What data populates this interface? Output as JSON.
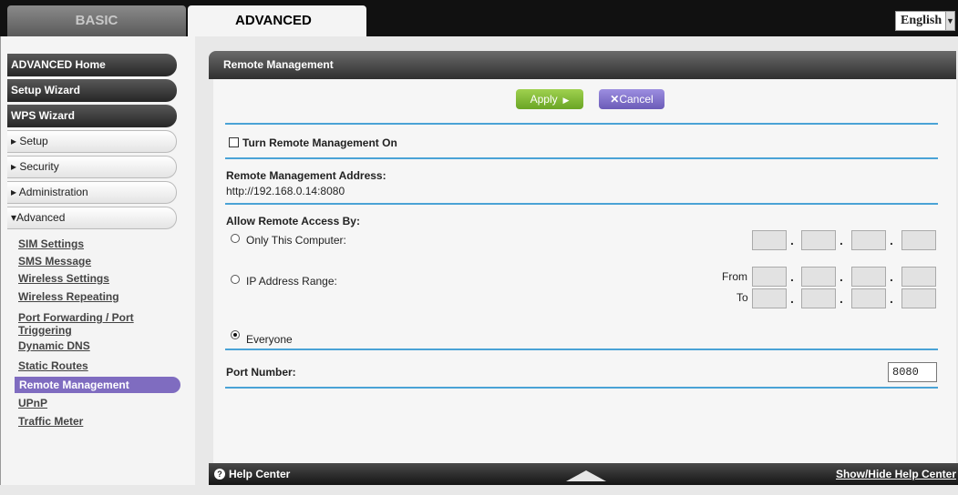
{
  "tabs": {
    "basic": "BASIC",
    "advanced": "ADVANCED"
  },
  "language": {
    "selected": "English"
  },
  "sidebar": {
    "main_items": [
      "ADVANCED Home",
      "Setup Wizard",
      "WPS Wizard"
    ],
    "sections": [
      "Setup",
      "Security",
      "Administration",
      "Advanced"
    ],
    "sub_items": [
      "SIM Settings",
      "SMS Message",
      "Wireless Settings",
      "Wireless Repeating",
      "Port Forwarding / Port Triggering",
      "Dynamic DNS",
      "Static Routes",
      "Remote Management",
      "UPnP",
      "Traffic Meter"
    ],
    "active_sub_item": "Remote Management"
  },
  "panel": {
    "title": "Remote Management",
    "apply_label": "Apply",
    "cancel_label": "Cancel",
    "turn_on_label": "Turn Remote Management On",
    "turn_on_checked": false,
    "address_label": "Remote Management Address:",
    "address_value": "http://192.168.0.14:8080",
    "allow_label": "Allow Remote Access By:",
    "opt_only_computer": "Only This Computer:",
    "opt_ip_range": "IP Address Range:",
    "from_label": "From",
    "to_label": "To",
    "opt_everyone": "Everyone",
    "selected_option": "Everyone",
    "port_label": "Port Number:",
    "port_value": "8080"
  },
  "help": {
    "center_label": "Help Center",
    "toggle_label": "Show/Hide Help Center"
  },
  "colors": {
    "apply": "#7bb832",
    "cancel": "#7d6dcc",
    "rule": "#4aa3d6",
    "active_nav": "#7f6cc0"
  }
}
